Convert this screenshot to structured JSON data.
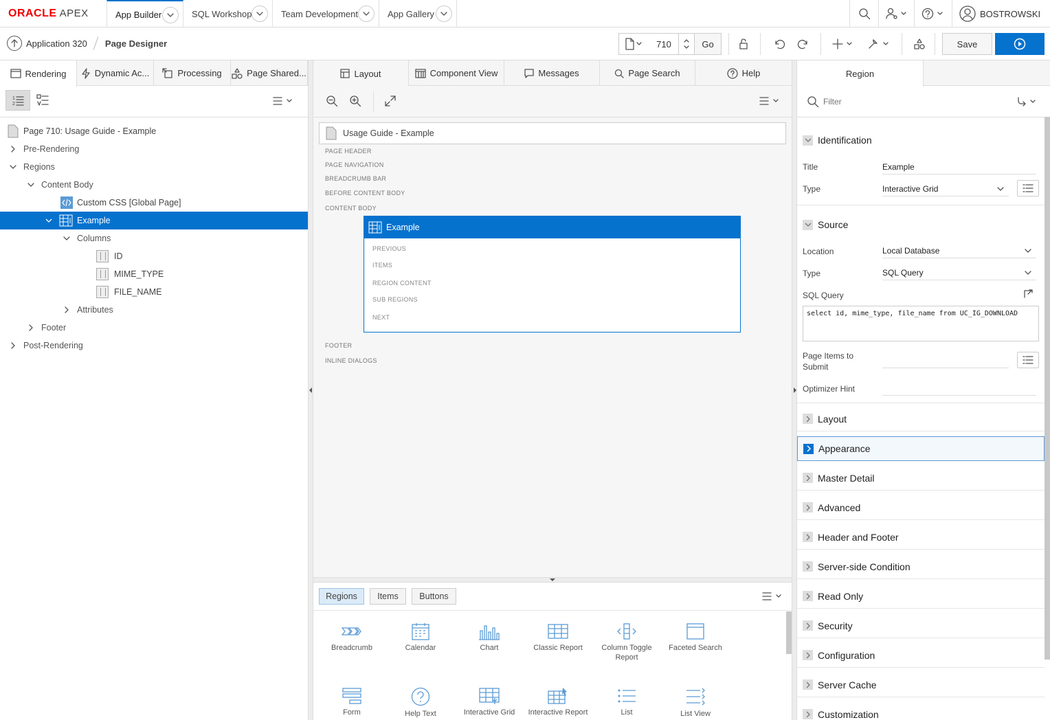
{
  "topbar": {
    "logo_oracle": "ORACLE",
    "logo_apex": "APEX",
    "tabs": [
      {
        "label": "App Builder"
      },
      {
        "label": "SQL Workshop"
      },
      {
        "label": "Team Development"
      },
      {
        "label": "App Gallery"
      }
    ],
    "user": "BOSTROWSKI"
  },
  "breadcrumb": {
    "app": "Application 320",
    "current": "Page Designer"
  },
  "toolbar": {
    "page_number": "710",
    "go_label": "Go",
    "save_label": "Save"
  },
  "left_tabs": [
    "Rendering",
    "Dynamic Ac...",
    "Processing",
    "Page Shared..."
  ],
  "tree": [
    {
      "label": "Page 710: Usage Guide - Example"
    },
    {
      "label": "Pre-Rendering"
    },
    {
      "label": "Regions"
    },
    {
      "label": "Content Body"
    },
    {
      "label": "Custom CSS [Global Page]"
    },
    {
      "label": "Example"
    },
    {
      "label": "Columns"
    },
    {
      "label": "ID"
    },
    {
      "label": "MIME_TYPE"
    },
    {
      "label": "FILE_NAME"
    },
    {
      "label": "Attributes"
    },
    {
      "label": "Footer"
    },
    {
      "label": "Post-Rendering"
    }
  ],
  "center_tabs": [
    "Layout",
    "Component View",
    "Messages",
    "Page Search",
    "Help"
  ],
  "layout": {
    "page_title": "Usage Guide - Example",
    "zones": [
      "PAGE HEADER",
      "PAGE NAVIGATION",
      "BREADCRUMB BAR",
      "BEFORE CONTENT BODY",
      "CONTENT BODY"
    ],
    "region_title": "Example",
    "region_zones": [
      "PREVIOUS",
      "ITEMS",
      "REGION CONTENT",
      "SUB REGIONS",
      "NEXT"
    ],
    "bottom_zones": [
      "FOOTER",
      "INLINE DIALOGS"
    ]
  },
  "gallery": {
    "tabs": [
      "Regions",
      "Items",
      "Buttons"
    ],
    "items": [
      "Breadcrumb",
      "Calendar",
      "Chart",
      "Classic Report",
      "Column Toggle Report",
      "Faceted Search",
      "Form",
      "Help Text",
      "Interactive Grid",
      "Interactive Report",
      "List",
      "List View"
    ]
  },
  "properties": {
    "tab": "Region",
    "filter_placeholder": "Filter",
    "identification": {
      "header": "Identification",
      "title_label": "Title",
      "title_value": "Example",
      "type_label": "Type",
      "type_value": "Interactive Grid"
    },
    "source": {
      "header": "Source",
      "location_label": "Location",
      "location_value": "Local Database",
      "type_label": "Type",
      "type_value": "SQL Query",
      "sql_label": "SQL Query",
      "sql_value": "select id, mime_type, file_name from UC_IG_DOWNLOAD",
      "items_label": "Page Items to Submit",
      "hint_label": "Optimizer Hint"
    },
    "collapsed_sections": [
      "Layout",
      "Appearance",
      "Master Detail",
      "Advanced",
      "Header and Footer",
      "Server-side Condition",
      "Read Only",
      "Security",
      "Configuration",
      "Server Cache",
      "Customization"
    ]
  },
  "colors": {
    "accent": "#0572ce",
    "brand_red": "#e00000"
  }
}
